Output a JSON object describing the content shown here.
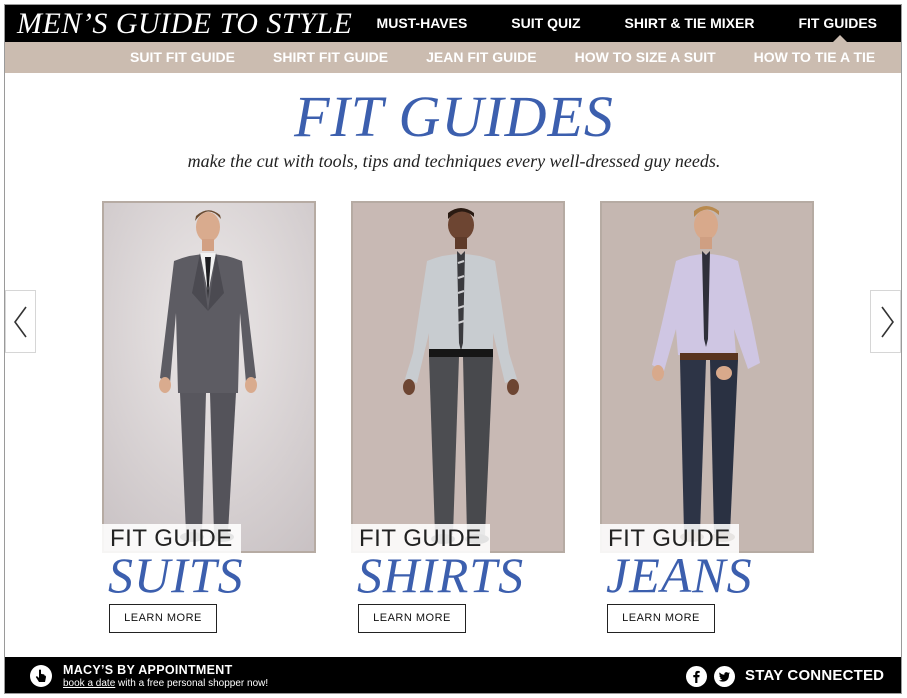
{
  "header": {
    "brand": "MEN’S GUIDE TO STYLE",
    "nav": [
      "MUST-HAVES",
      "SUIT QUIZ",
      "SHIRT & TIE MIXER",
      "FIT GUIDES"
    ],
    "active_nav": "FIT GUIDES"
  },
  "subnav": [
    "SUIT FIT GUIDE",
    "SHIRT FIT GUIDE",
    "JEAN FIT GUIDE",
    "HOW TO SIZE A SUIT",
    "HOW TO TIE A TIE"
  ],
  "hero": {
    "title": "FIT GUIDES",
    "subtitle": "make the cut with tools, tips and techniques every well-dressed guy needs."
  },
  "carousel": {
    "prev_icon": "chevron-left-icon",
    "next_icon": "chevron-right-icon"
  },
  "cards": [
    {
      "tag": "FIT GUIDE",
      "category": "SUITS",
      "button": "LEARN MORE"
    },
    {
      "tag": "FIT GUIDE",
      "category": "SHIRTS",
      "button": "LEARN MORE"
    },
    {
      "tag": "FIT GUIDE",
      "category": "JEANS",
      "button": "LEARN MORE"
    }
  ],
  "footer": {
    "appt_title": "MACY’S BY APPOINTMENT",
    "appt_link": "book a date",
    "appt_rest": " with a free personal shopper now!",
    "icons": [
      "hand-pointer-icon",
      "facebook-icon",
      "twitter-icon"
    ],
    "stay_connected": "STAY CONNECTED"
  },
  "colors": {
    "accent_blue": "#3c5fae",
    "subnav_bg": "#cbbcb0",
    "bar_bg": "#000000"
  }
}
